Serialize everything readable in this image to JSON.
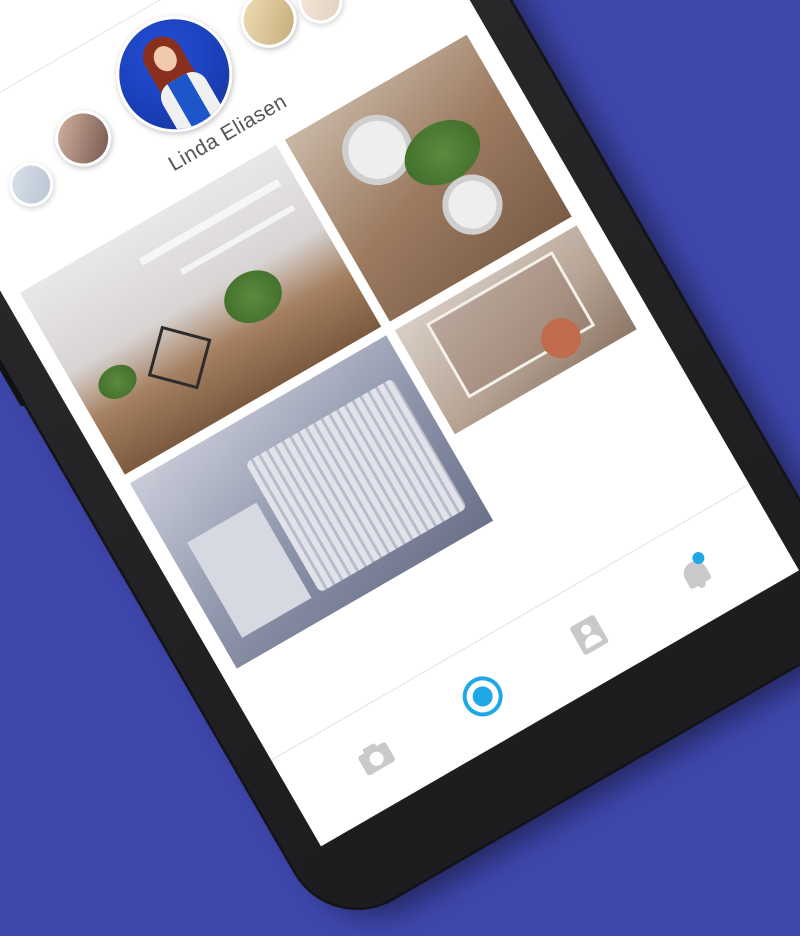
{
  "profile": {
    "name": "Linda Eliasen"
  },
  "header": {
    "menu_icon": "hamburger-icon",
    "search_icon": "search-icon"
  },
  "gallery": {
    "photos": [
      "living-room",
      "table-plant",
      "bedroom",
      "wall-art"
    ]
  },
  "bottom_nav": {
    "items": [
      "camera-icon",
      "record-icon",
      "contact-icon",
      "bell-icon"
    ],
    "notification": true
  },
  "colors": {
    "background": "#3f47ad",
    "accent": "#1ea8e6",
    "avatar_ring": "#1a3fb8"
  }
}
